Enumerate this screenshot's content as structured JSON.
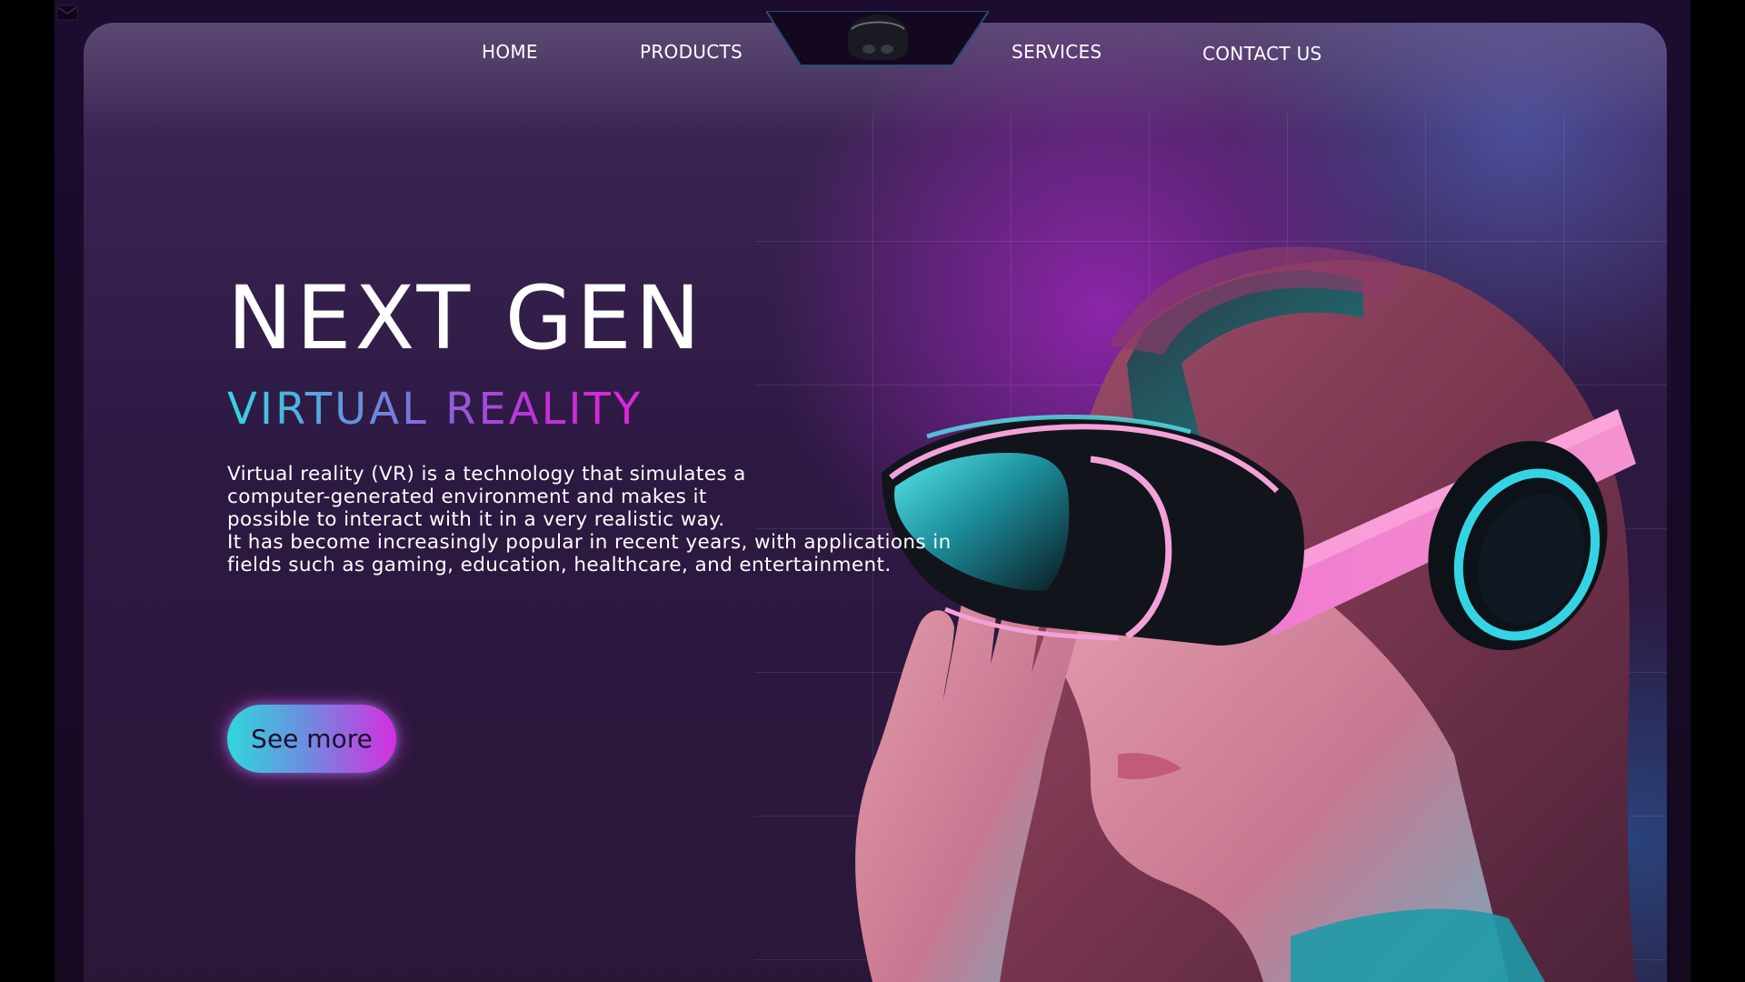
{
  "nav": {
    "home": "HOME",
    "products": "PRODUCTS",
    "services": "SERVICES",
    "contact": "CONTACT US",
    "logo_icon": "vr-headset-icon"
  },
  "hero": {
    "title": "NEXT GEN",
    "subtitle": "VIRTUAL REALITY",
    "body": [
      "Virtual reality (VR) is a technology that simulates a",
      "computer-generated environment and makes it",
      "possible to interact with it in a very realistic way.",
      "It has become increasingly popular in recent years, with applications in",
      "fields such as gaming, education, healthcare, and entertainment."
    ],
    "cta_label": "See more"
  },
  "colors": {
    "background": "#1c0c30",
    "accent_cyan": "#2fd8dc",
    "accent_magenta": "#e027d8",
    "text": "#ffffff"
  }
}
